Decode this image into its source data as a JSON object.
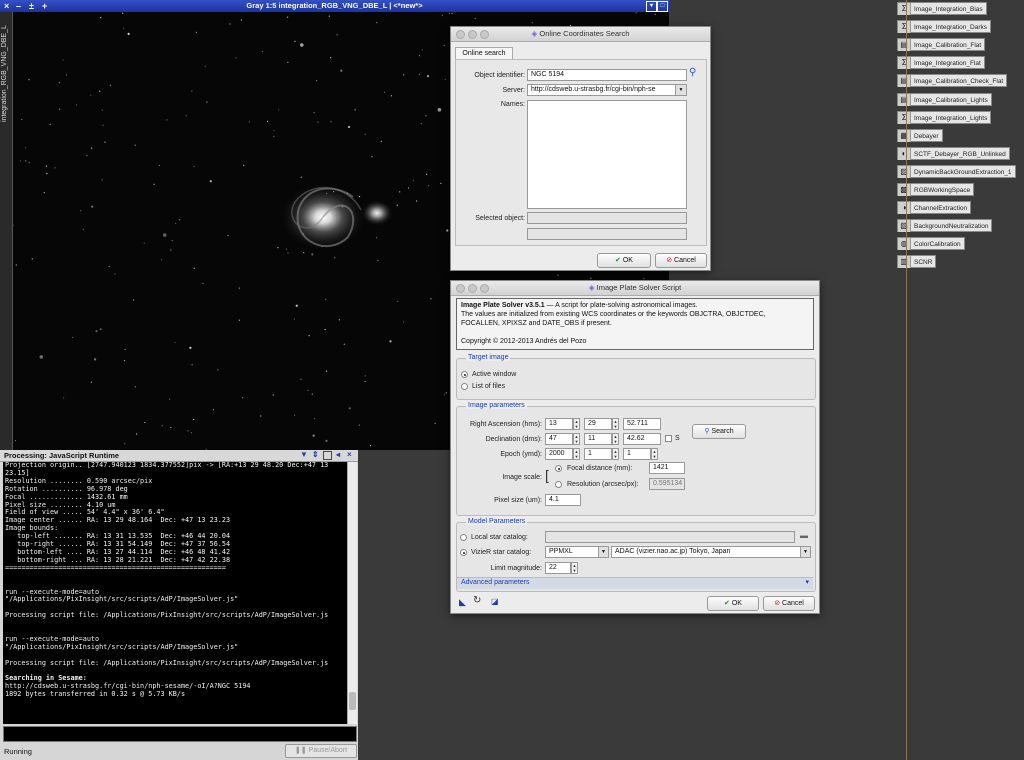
{
  "image_window": {
    "title": "Gray 1:5 integration_RGB_VNG_DBE_L | <*new*>",
    "side_tab": "integration_RGB_VNG_DBE_L",
    "ctrl_left": [
      "×",
      "–",
      "±",
      "+"
    ]
  },
  "console": {
    "title": "Processing: JavaScript Runtime",
    "output": "Projection origin.. [2747.940123 1834.377552]pix -> [RA:+13 29 48.20 Dec:+47 13\n23.15]\nResolution ........ 0.590 arcsec/pix\nRotation .......... 96.978 deg\nFocal ............. 1432.61 mm\nPixel size ........ 4.10 um\nField of view ..... 54' 4.4\" x 36' 6.4\"\nImage center ...... RA: 13 29 48.164  Dec: +47 13 23.23\nImage bounds:\n   top-left ....... RA: 13 31 13.535  Dec: +46 44 20.04\n   top-right ...... RA: 13 31 54.149  Dec: +47 37 56.54\n   bottom-left .... RA: 13 27 44.114  Dec: +46 48 41.42\n   bottom-right ... RA: 13 28 21.221  Dec: +47 42 22.38\n======================================================\n\n\nrun --execute-mode=auto\n\"/Applications/PixInsight/src/scripts/AdP/ImageSolver.js\"\n\nProcessing script file: /Applications/PixInsight/src/scripts/AdP/ImageSolver.js\n\n\nrun --execute-mode=auto\n\"/Applications/PixInsight/src/scripts/AdP/ImageSolver.js\"\n\nProcessing script file: /Applications/PixInsight/src/scripts/AdP/ImageSolver.js\n\n",
    "searching_label": "Searching in Sesame:",
    "searching_lines": "http://cdsweb.u-strasbg.fr/cgi-bin/nph-sesame/-oI/A?NGC 5194\n1892 bytes transferred in 0.32 s @ 5.73 KB/s",
    "status": "Running",
    "pause_button": "Pause/Abort"
  },
  "coords_dialog": {
    "title": "Online Coordinates Search",
    "tab": "Online search",
    "object_identifier_label": "Object identifier:",
    "object_identifier_value": "NGC 5194",
    "server_label": "Server:",
    "server_value": "http://cdsweb.u-strasbg.fr/cgi-bin/nph-se",
    "names_label": "Names:",
    "selected_label": "Selected object:",
    "ok": "OK",
    "cancel": "Cancel"
  },
  "solver": {
    "title": "Image Plate Solver Script",
    "info_bold": "Image Plate Solver v3.5.1",
    "info_text": " — A script for plate-solving astronomical images.",
    "info_line2": "The values are initialized from existing WCS coordinates or the keywords OBJCTRA, OBJCTDEC,",
    "info_line3": "FOCALLEN, XPIXSZ and DATE_OBS if present.",
    "copyright": "Copyright © 2012-2013 Andrés del Pozo",
    "target_head": "Target image",
    "active_window": "Active window",
    "list_of_files": "List of files",
    "params_head": "Image parameters",
    "ra_label": "Right Ascension (hms):",
    "ra": [
      "13",
      "29",
      "52.711"
    ],
    "dec_label": "Declination (dms):",
    "dec": [
      "47",
      "11",
      "42.62"
    ],
    "s_label": "S",
    "search": "Search",
    "epoch_label": "Epoch (ymd):",
    "epoch": [
      "2000",
      "1",
      "1"
    ],
    "scale_label": "Image scale:",
    "focal_label": "Focal distance (mm):",
    "focal_value": "1421",
    "resolution_label": "Resolution (arcsec/px):",
    "resolution_value": "0.595134",
    "pixel_label": "Pixel size (um):",
    "pixel_value": "4.1",
    "model_head": "Model Parameters",
    "local_label": "Local star catalog:",
    "vizier_label": "VizieR star catalog:",
    "catalog_value": "PPMXL",
    "mirror_value": "ADAC (vizier.nao.ac.jp) Tokyo, Japan",
    "limit_label": "Limit magnitude:",
    "limit_value": "22",
    "advanced": "Advanced parameters",
    "ok": "OK",
    "cancel": "Cancel"
  },
  "process_icons": [
    {
      "label": "Image_Integration_Bias",
      "icon": "sigma-icon"
    },
    {
      "label": "Image_Integration_Darks",
      "icon": "sigma-icon"
    },
    {
      "label": "Image_Calibration_Flat",
      "icon": "calibration-icon"
    },
    {
      "label": "Image_Integration_Flat",
      "icon": "sigma-icon"
    },
    {
      "label": "Image_Calibration_Check_Flat",
      "icon": "calibration-icon"
    },
    {
      "label": "Image_Calibration_Lights",
      "icon": "calibration-icon"
    },
    {
      "label": "Image_Integration_Lights",
      "icon": "sigma-icon"
    },
    {
      "label": "Debayer",
      "icon": "debayer-icon"
    },
    {
      "label": "SCTF_Debayer_RGB_Unlinked",
      "icon": "stf-icon"
    },
    {
      "label": "DynamicBackGroundExtraction_1",
      "icon": "dbe-icon"
    },
    {
      "label": "RGBWorkingSpace",
      "icon": "rgb-icon"
    },
    {
      "label": "ChannelExtraction",
      "icon": "channel-icon"
    },
    {
      "label": "BackgroundNeutralization",
      "icon": "neutral-icon"
    },
    {
      "label": "ColorCalibration",
      "icon": "color-icon"
    },
    {
      "label": "SCNR",
      "icon": "scnr-icon"
    }
  ],
  "colors": {
    "title_blue": "#1c33a0",
    "section_blue": "#1d3ea8",
    "desktop": "#3a3a3a"
  }
}
